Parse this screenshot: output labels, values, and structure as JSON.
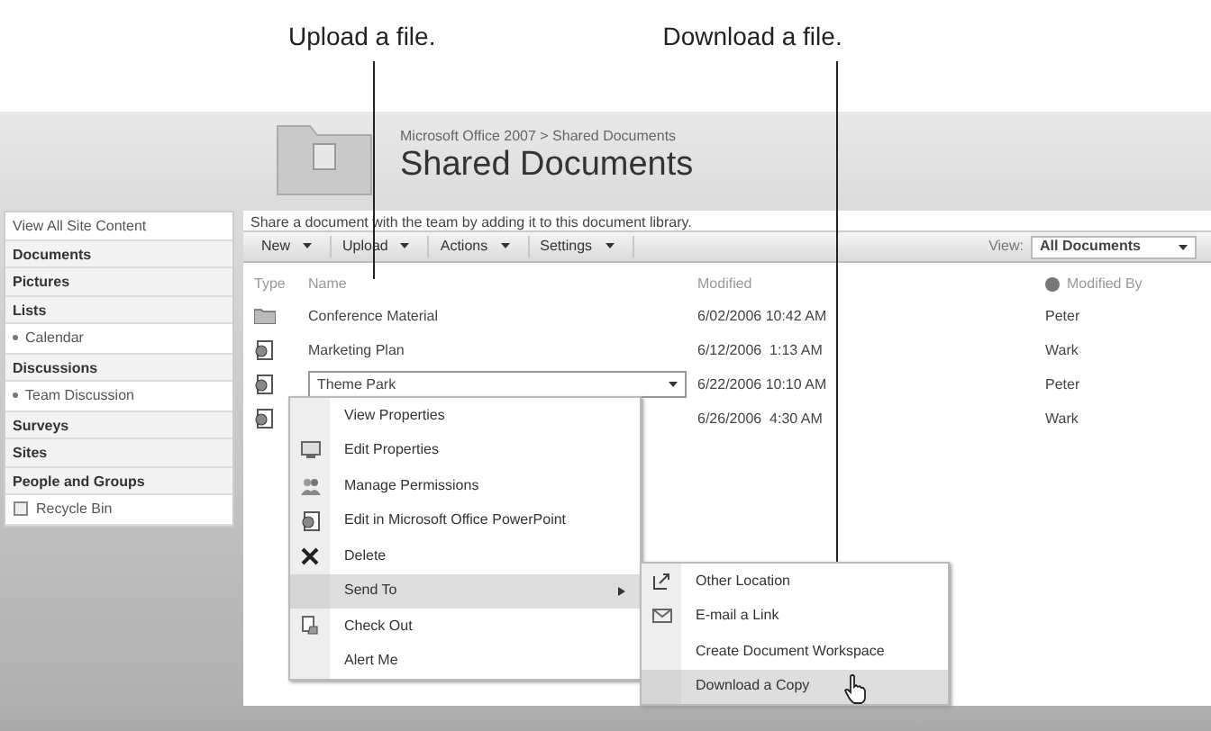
{
  "callouts": [
    {
      "text": "Upload a file."
    },
    {
      "text": "Download a file."
    }
  ],
  "breadcrumb": "Microsoft Office 2007 > Shared Documents",
  "title": "Shared Documents",
  "sidebar": {
    "items": [
      {
        "kind": "link",
        "label": "View All Site Content"
      },
      {
        "kind": "heading",
        "label": "Documents"
      },
      {
        "kind": "heading",
        "label": "Pictures"
      },
      {
        "kind": "heading",
        "label": "Lists"
      },
      {
        "kind": "sub",
        "label": "Calendar"
      },
      {
        "kind": "heading",
        "label": "Discussions"
      },
      {
        "kind": "sub",
        "label": "Team Discussion"
      },
      {
        "kind": "heading",
        "label": "Surveys"
      },
      {
        "kind": "heading",
        "label": "Sites"
      },
      {
        "kind": "heading",
        "label": "People and Groups"
      },
      {
        "kind": "recycle",
        "label": "Recycle Bin"
      }
    ]
  },
  "description": "Share a document with the team by adding it to this document library.",
  "toolbar": {
    "buttons": [
      {
        "label": "New"
      },
      {
        "label": "Upload"
      },
      {
        "label": "Actions"
      },
      {
        "label": "Settings"
      }
    ],
    "view_label": "View:",
    "view_value": "All Documents"
  },
  "table": {
    "columns": [
      "Type",
      "Name",
      "Modified",
      "Modified By"
    ],
    "rows": [
      {
        "kind": "folder",
        "name": "Conference Material",
        "modified": "6/02/2006 10:42 AM",
        "modified_by": "Peter",
        "selected": false
      },
      {
        "kind": "document",
        "name": "Marketing Plan",
        "modified": "6/12/2006  1:13 AM",
        "modified_by": "Wark",
        "selected": false
      },
      {
        "kind": "document",
        "name": "Theme Park",
        "modified": "6/22/2006 10:10 AM",
        "modified_by": "Peter",
        "selected": true
      },
      {
        "kind": "document",
        "modified": "6/26/2006  4:30 AM",
        "modified_by": "Wark",
        "selected": false
      }
    ]
  },
  "context_menu": [
    {
      "label": "View Properties",
      "kind": "plain",
      "selected": false
    },
    {
      "label": "Edit Properties",
      "kind": "edit",
      "selected": false
    },
    {
      "label": "Manage Permissions",
      "kind": "people",
      "selected": false
    },
    {
      "label": "Edit in Microsoft Office PowerPoint",
      "kind": "document",
      "selected": false
    },
    {
      "label": "Delete",
      "kind": "delete",
      "selected": false
    },
    {
      "label": "Send To",
      "kind": "submenu",
      "selected": true
    },
    {
      "label": "Check Out",
      "kind": "checkout",
      "selected": false
    },
    {
      "label": "Alert Me",
      "kind": "plain",
      "selected": false
    }
  ],
  "submenu": [
    {
      "label": "Other Location",
      "kind": "location",
      "selected": false
    },
    {
      "label": "E-mail a Link",
      "kind": "email",
      "selected": false
    },
    {
      "label": "Create Document Workspace",
      "kind": "plain",
      "selected": false
    },
    {
      "label": "Download a Copy",
      "kind": "plain",
      "selected": true
    }
  ]
}
